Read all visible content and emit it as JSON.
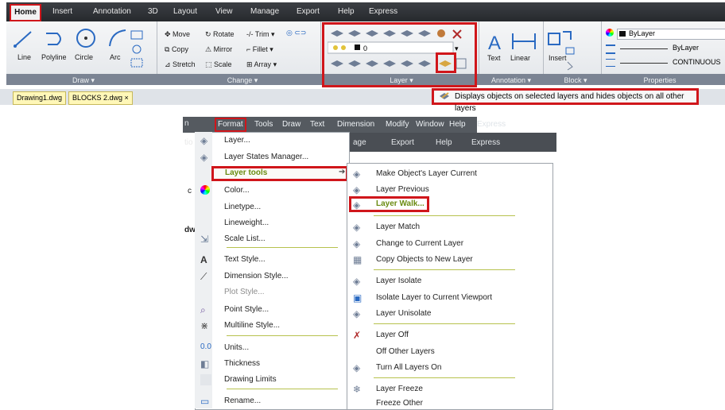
{
  "ribbon": {
    "tabs": [
      "Home",
      "Insert",
      "Annotation",
      "3D",
      "Layout",
      "View",
      "Manage",
      "Export",
      "Help",
      "Express"
    ],
    "draw": {
      "tools": [
        "Line",
        "Polyline",
        "Circle",
        "Arc"
      ],
      "panel": "Draw"
    },
    "modify": {
      "rows": [
        [
          "Move",
          "Rotate",
          "Trim"
        ],
        [
          "Copy",
          "Mirror",
          "Fillet"
        ],
        [
          "Stretch",
          "Scale",
          "Array"
        ]
      ],
      "panel": "Change"
    },
    "layer": {
      "current": "0",
      "panel": "Layer"
    },
    "annotation": {
      "text": "Text",
      "linear": "Linear",
      "panel": "Annotation"
    },
    "block": {
      "insert": "Insert",
      "panel": "Block"
    },
    "properties": {
      "color": "ByLayer",
      "lineweight": "ByLayer",
      "linetype": "CONTINUOUS",
      "panel": "Properties"
    }
  },
  "files": [
    "Drawing1.dwg",
    "BLOCKS 2.dwg"
  ],
  "tooltip": "Displays objects on selected layers and hides objects on all other layers",
  "menubar": {
    "items": [
      "Format",
      "Tools",
      "Draw",
      "Text",
      "Dimension",
      "Modify",
      "Window",
      "Help",
      "Express"
    ],
    "behind": [
      "age",
      "Export",
      "Help",
      "Express"
    ]
  },
  "format_menu": {
    "items": [
      {
        "label": "Layer...",
        "icon": "layer-icon"
      },
      {
        "label": "Layer States Manager...",
        "icon": "layer-states-icon"
      },
      {
        "label": "Layer tools",
        "icon": ""
      },
      {
        "label": "Color...",
        "icon": "color-wheel-icon"
      },
      {
        "label": "Linetype...",
        "icon": ""
      },
      {
        "label": "Lineweight...",
        "icon": ""
      },
      {
        "label": "Scale List...",
        "icon": "scale-list-icon"
      },
      {
        "label": "Text Style...",
        "icon": "text-style-icon"
      },
      {
        "label": "Dimension Style...",
        "icon": "dimension-style-icon"
      },
      {
        "label": "Plot Style...",
        "icon": ""
      },
      {
        "label": "Point Style...",
        "icon": "point-style-icon"
      },
      {
        "label": "Multiline Style...",
        "icon": "multiline-style-icon"
      },
      {
        "label": "Units...",
        "icon": "units-icon"
      },
      {
        "label": "Thickness",
        "icon": "thickness-icon"
      },
      {
        "label": "Drawing Limits",
        "icon": "drawing-limits-icon"
      },
      {
        "label": "Rename...",
        "icon": "rename-icon"
      }
    ]
  },
  "layer_tools_menu": {
    "items": [
      "Make Object's Layer Current",
      "Layer Previous",
      "Layer Walk...",
      "Layer Match",
      "Change to Current Layer",
      "Copy Objects to New Layer",
      "Layer Isolate",
      "Isolate Layer to Current Viewport",
      "Layer Unisolate",
      "Layer Off",
      "Off Other Layers",
      "Turn All Layers On",
      "Layer Freeze",
      "Freeze Other"
    ]
  },
  "behind_fragments": [
    "n",
    "tio",
    "c",
    "dw"
  ],
  "colors": {
    "highlight": "#d0161b",
    "menu_green": "#6a8b11",
    "ribbon_dark": "#2b2e33"
  }
}
